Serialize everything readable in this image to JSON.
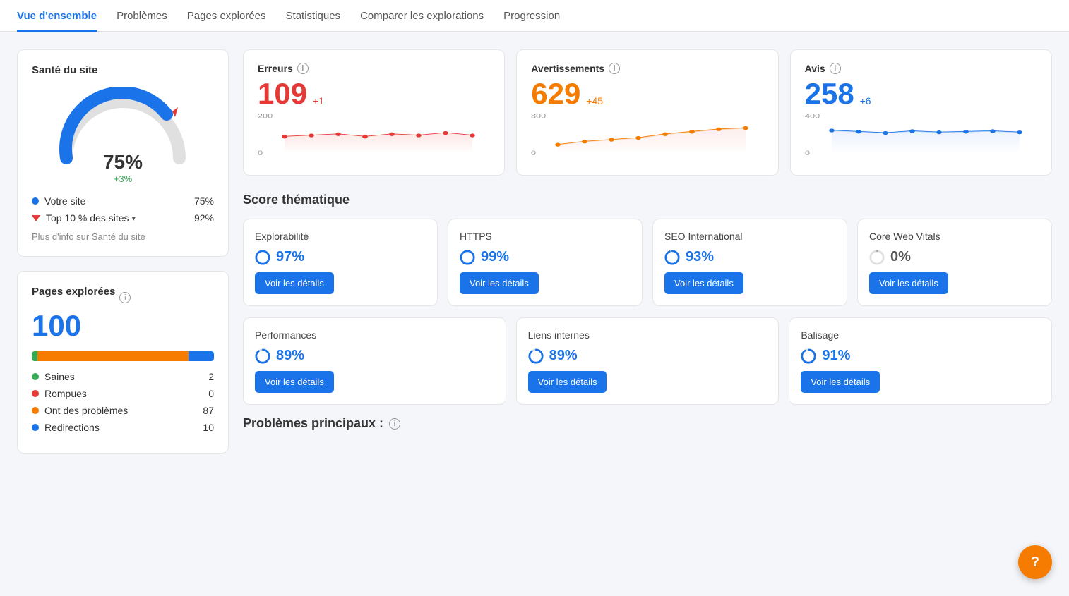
{
  "nav": {
    "tabs": [
      {
        "label": "Vue d'ensemble",
        "active": true
      },
      {
        "label": "Problèmes",
        "active": false
      },
      {
        "label": "Pages explorées",
        "active": false
      },
      {
        "label": "Statistiques",
        "active": false
      },
      {
        "label": "Comparer les explorations",
        "active": false
      },
      {
        "label": "Progression",
        "active": false
      }
    ]
  },
  "sante": {
    "title": "Santé du site",
    "percent": "75%",
    "delta": "+3%",
    "votre_site_label": "Votre site",
    "votre_site_value": "75%",
    "top10_label": "Top 10 % des sites",
    "top10_value": "92%",
    "more_info_label": "Plus d'info sur Santé du site"
  },
  "pages_explorees": {
    "title": "Pages explorées",
    "count": "100",
    "legend": [
      {
        "label": "Saines",
        "value": "2",
        "color": "#34a853"
      },
      {
        "label": "Rompues",
        "value": "0",
        "color": "#e53935"
      },
      {
        "label": "Ont des problèmes",
        "value": "87",
        "color": "#f57c00"
      },
      {
        "label": "Redirections",
        "value": "10",
        "color": "#1a73e8"
      }
    ]
  },
  "erreurs": {
    "label": "Erreurs",
    "value": "109",
    "delta": "+1",
    "y_max": "200",
    "y_min": "0",
    "color": "#e53935",
    "fill": "#fce8e6"
  },
  "avertissements": {
    "label": "Avertissements",
    "value": "629",
    "delta": "+45",
    "y_max": "800",
    "y_min": "0",
    "color": "#f57c00",
    "fill": "#fce8e6"
  },
  "avis": {
    "label": "Avis",
    "value": "258",
    "delta": "+6",
    "y_max": "400",
    "y_min": "0",
    "color": "#1a73e8",
    "fill": "#e8f0fe"
  },
  "score_thematique": {
    "title": "Score thématique",
    "cards_row1": [
      {
        "title": "Explorabilité",
        "percent": "97%",
        "color": "#1a73e8",
        "btn": "Voir les détails"
      },
      {
        "title": "HTTPS",
        "percent": "99%",
        "color": "#1a73e8",
        "btn": "Voir les détails"
      },
      {
        "title": "SEO International",
        "percent": "93%",
        "color": "#1a73e8",
        "btn": "Voir les détails"
      },
      {
        "title": "Core Web Vitals",
        "percent": "0%",
        "color": "#aaa",
        "btn": "Voir les détails"
      }
    ],
    "cards_row2": [
      {
        "title": "Performances",
        "percent": "89%",
        "color": "#1a73e8",
        "btn": "Voir les détails"
      },
      {
        "title": "Liens internes",
        "percent": "89%",
        "color": "#1a73e8",
        "btn": "Voir les détails"
      },
      {
        "title": "Balisage",
        "percent": "91%",
        "color": "#1a73e8",
        "btn": "Voir les détails"
      }
    ]
  },
  "problemes": {
    "title": "Problèmes principaux :"
  },
  "float_btn": "?"
}
